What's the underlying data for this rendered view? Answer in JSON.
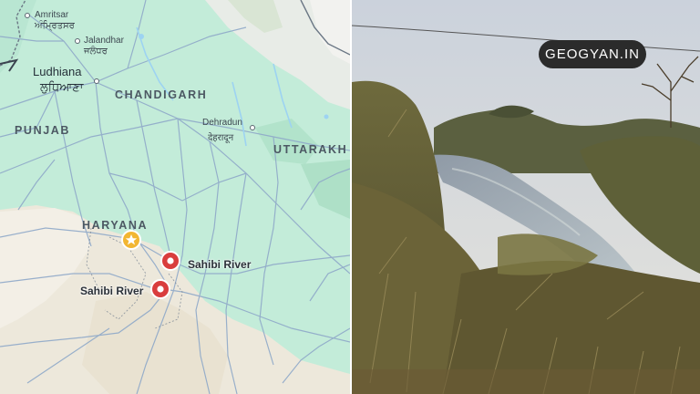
{
  "map": {
    "states": [
      "PUNJAB",
      "CHANDIGARH",
      "HARYANA",
      "UTTARAKH"
    ],
    "cities": {
      "amritsar": "Amritsar",
      "amritsar_gurmukhi": "ਅੰਮ੍ਰਿਤਸਰ",
      "jalandhar": "Jalandhar",
      "jalandhar_gurmukhi": "ਜਲੰਧਰ",
      "ludhiana": "Ludhiana",
      "ludhiana_gurmukhi": "ਲੁਧਿਆਣਾ",
      "dehradun": "Dehradun",
      "dehradun_hindi": "देहरादून"
    },
    "markers": [
      {
        "label": "Sahibi River",
        "type": "red-pin"
      },
      {
        "label": "Sahibi River",
        "type": "red-pin"
      }
    ],
    "star_marker": "star-icon",
    "colors": {
      "land": "#bfe9d6",
      "plains": "#ece6d8",
      "highlands": "#e6e9e4",
      "roads": "#8aa6c8",
      "pin": "#d93d3d",
      "star": "#f2b632"
    }
  },
  "photo": {
    "watermark": "GEOGYAN.IN",
    "scene": "river"
  }
}
